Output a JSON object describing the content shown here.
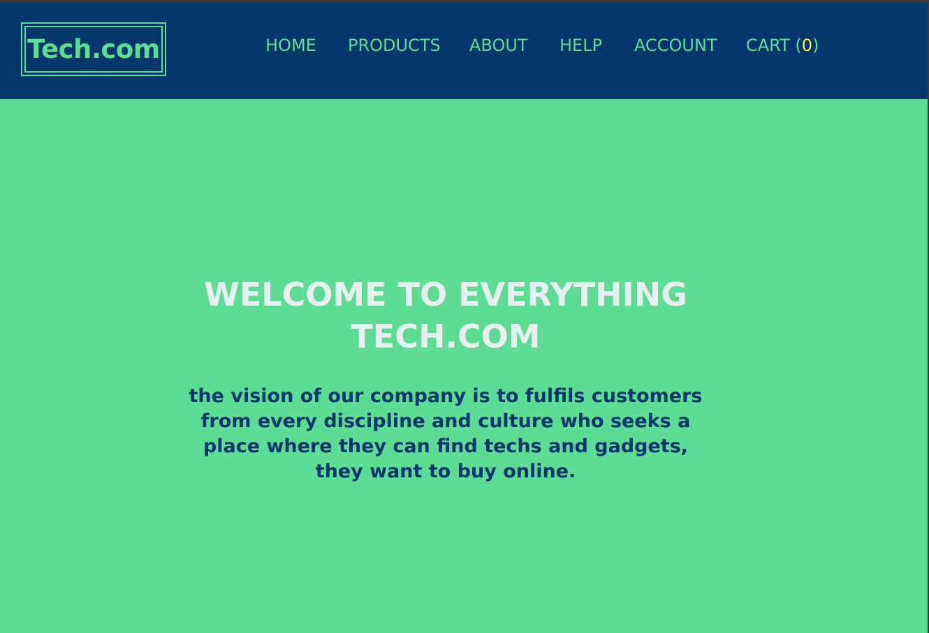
{
  "header": {
    "logo_text": "Tech.com",
    "nav": {
      "home": "HOME",
      "products": "PRODUCTS",
      "about": "ABOUT",
      "help": "HELP",
      "account": "ACCOUNT",
      "cart_label": "CART (",
      "cart_count": "0",
      "cart_close": ")"
    }
  },
  "hero": {
    "title": "WELCOME TO EVERYTHING TECH.COM",
    "text": "the vision of our company is to fulfils customers from every discipline and culture who seeks a place where they can find techs and gadgets, they want to buy online."
  },
  "colors": {
    "header_bg": "#03376b",
    "page_bg": "#5ddc95",
    "accent": "#5ddc95",
    "cart_count": "#f5f536",
    "title": "#e8f0ef",
    "body_text": "#03376b"
  }
}
